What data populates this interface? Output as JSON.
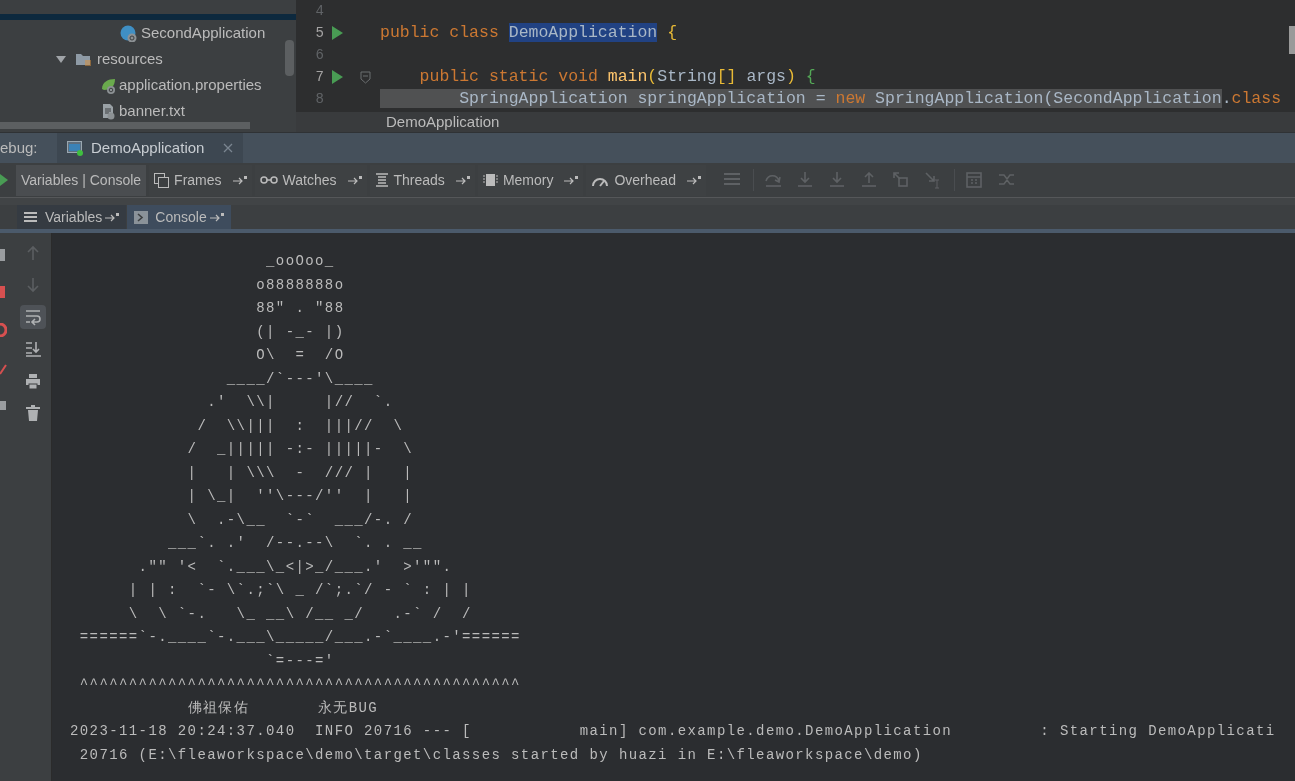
{
  "project_tree": [
    {
      "label": "SecondApplication",
      "kind": "spring-class"
    },
    {
      "label": "resources",
      "kind": "folder",
      "expanded": true,
      "children": [
        {
          "label": "application.properties",
          "kind": "spring-config"
        },
        {
          "label": "banner.txt",
          "kind": "text-file"
        }
      ]
    }
  ],
  "editor": {
    "lines": [
      {
        "number": "4",
        "runnable": false,
        "foldable": false
      },
      {
        "number": "5",
        "runnable": true,
        "foldable": false,
        "tokens": [
          {
            "text": "public class ",
            "kind": "keyword",
            "marked": false
          },
          {
            "text": "DemoApplication",
            "kind": "selected-name",
            "marked": false
          },
          {
            "text": " {",
            "kind": "brace",
            "marked": false
          }
        ]
      },
      {
        "number": "6",
        "runnable": false,
        "foldable": false
      },
      {
        "number": "7",
        "runnable": true,
        "foldable": true,
        "tokens": [
          {
            "text": "    public static void ",
            "kind": "keyword",
            "marked": false
          },
          {
            "text": "main",
            "kind": "method",
            "marked": false
          },
          {
            "text": "(",
            "kind": "brace",
            "marked": false
          },
          {
            "text": "String",
            "kind": "plain",
            "marked": false
          },
          {
            "text": "[]",
            "kind": "brace",
            "marked": false
          },
          {
            "text": " args",
            "kind": "plain",
            "marked": false
          },
          {
            "text": ")",
            "kind": "brace",
            "marked": false
          },
          {
            "text": " {",
            "kind": "brace-green",
            "marked": false
          }
        ]
      },
      {
        "number": "8",
        "runnable": false,
        "foldable": false,
        "tokens": [
          {
            "text": "        SpringApplication springApplication = ",
            "kind": "plain",
            "marked": true
          },
          {
            "text": "new ",
            "kind": "keyword",
            "marked": true
          },
          {
            "text": "SpringApplication(SecondApplication",
            "kind": "plain",
            "marked": true
          },
          {
            "text": ".",
            "kind": "plain",
            "marked": false
          },
          {
            "text": "class",
            "kind": "keyword",
            "marked": false
          }
        ]
      }
    ],
    "breadcrumb": "DemoApplication"
  },
  "debug_bar": {
    "label": "ebug:",
    "tabs": [
      {
        "label": "DemoApplication"
      }
    ]
  },
  "debugger_tabs": [
    {
      "label": "Variables | Console",
      "pinnable": false,
      "selected": true
    },
    {
      "label": "Frames",
      "pinnable": true,
      "selected": false
    },
    {
      "label": "Watches",
      "pinnable": true,
      "selected": false
    },
    {
      "label": "Threads",
      "pinnable": true,
      "selected": false
    },
    {
      "label": "Memory",
      "pinnable": true,
      "selected": false
    },
    {
      "label": "Overhead",
      "pinnable": true,
      "selected": false
    }
  ],
  "debugger_actions": [
    {
      "kind": "menu"
    },
    {
      "kind": "step-over"
    },
    {
      "kind": "step-into"
    },
    {
      "kind": "force-step-into"
    },
    {
      "kind": "step-out"
    },
    {
      "kind": "drop-frame"
    },
    {
      "kind": "run-to-cursor"
    },
    {
      "kind": "evaluate"
    },
    {
      "kind": "trace"
    }
  ],
  "console_tabs": [
    {
      "label": "Variables",
      "selected": false
    },
    {
      "label": "Console",
      "selected": true
    }
  ],
  "console_tools": [
    {
      "kind": "up",
      "disabled": true,
      "on": false
    },
    {
      "kind": "down",
      "disabled": true,
      "on": false
    },
    {
      "kind": "wrap",
      "disabled": false,
      "on": true
    },
    {
      "kind": "scroll-end",
      "disabled": false,
      "on": false
    },
    {
      "kind": "print",
      "disabled": false,
      "on": false
    },
    {
      "kind": "trash",
      "disabled": false,
      "on": false
    }
  ],
  "console": {
    "lines": [
      "                    _ooOoo_",
      "                   o8888888o",
      "                   88\" . \"88",
      "                   (| -_- |)",
      "                   O\\  =  /O",
      "                ____/`---'\\____",
      "              .'  \\\\|     |//  `.",
      "             /  \\\\|||  :  |||//  \\",
      "            /  _||||| -:- |||||-  \\",
      "            |   | \\\\\\  -  /// |   |",
      "            | \\_|  ''\\---/''  |   |",
      "            \\  .-\\__  `-`  ___/-. /",
      "          ___`. .'  /--.--\\  `. . __",
      "       .\"\" '<  `.___\\_<|>_/___.'  >'\"\".",
      "      | | :  `- \\`.;`\\ _ /`;.`/ - ` : | |",
      "      \\  \\ `-.   \\_ __\\ /__ _/   .-` /  /",
      " ======`-.____`-.___\\_____/___.-`____.-'======",
      "                    `=---='",
      " ^^^^^^^^^^^^^^^^^^^^^^^^^^^^^^^^^^^^^^^^^^^^^",
      "            佛祖保佑       永无BUG",
      "2023-11-18 20:24:37.040  INFO 20716 --- [           main] com.example.demo.DemoApplication         : Starting DemoApplicati",
      " 20716 (E:\\fleaworkspace\\demo\\target\\classes started by huazi in E:\\fleaworkspace\\demo)"
    ]
  }
}
